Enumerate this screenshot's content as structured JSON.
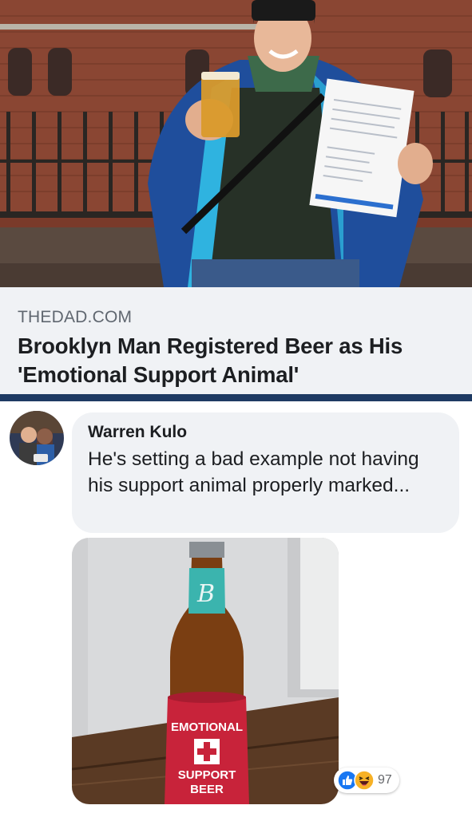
{
  "link_preview": {
    "source": "THEDAD.COM",
    "headline": "Brooklyn Man Registered Beer as His 'Emotional Support Animal'",
    "image": "photo-man-holding-beer-and-document"
  },
  "comment": {
    "author": "Warren Kulo",
    "text": "He's setting a bad example not having his support animal properly marked...",
    "attachment": {
      "image": "photo-beer-bottle-in-koozie",
      "koozie_lines": [
        "EMOTIONAL",
        "SUPPORT",
        "BEER"
      ]
    },
    "reactions": {
      "icons": [
        "like-icon",
        "haha-icon"
      ],
      "count": "97"
    }
  },
  "colors": {
    "divider": "#1e3a63",
    "like_blue": "#1877f2",
    "haha_yellow": "#f7b125",
    "koozie_red": "#c8233a"
  }
}
